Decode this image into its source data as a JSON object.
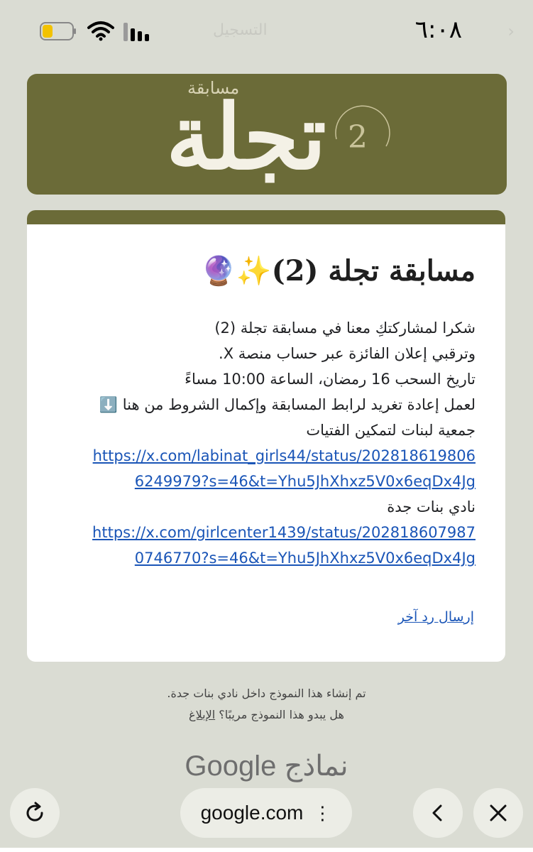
{
  "status_bar": {
    "time": "٦:٠٨",
    "faded_title": "التسجيل"
  },
  "banner": {
    "small_text": "مسابقة",
    "big_text": "تجلة",
    "number": "2"
  },
  "form": {
    "title": "مسابقة تجلة (2)✨🔮",
    "lines": {
      "l1": "شكرا لمشاركتكِ معنا في مسابقة تجلة (2)",
      "l2": "وترقبي إعلان الفائزة عبر حساب منصة X.",
      "l3": "تاريخ السحب 16 رمضان، الساعة 10:00 مساءً",
      "l4": "لعمل إعادة تغريد لرابط المسابقة وإكمال الشروط من هنا ⬇️",
      "l5": "جمعية لبنات لتمكين الفتيات",
      "link1_part1": "https://x.com/labinat_girls44/status/202818619806",
      "link1_part2": "6249979?s=46&t=Yhu5JhXhxz5V0x6eqDx4Jg",
      "l6": "نادي بنات جدة",
      "link2_part1": "https://x.com/girlcenter1439/status/202818607987",
      "link2_part2": "0746770?s=46&t=Yhu5JhXhxz5V0x6eqDx4Jg"
    },
    "resend_link": "إرسال رد آخر"
  },
  "footer": {
    "created_note": "تم إنشاء هذا النموذج داخل نادي بنات جدة.",
    "suspicious_question": "هل يبدو هذا النموذج مريبًا؟",
    "report_link": "الإبلاغ",
    "brand_google": "Google",
    "brand_forms": "نماذج"
  },
  "browser": {
    "url": "google.com",
    "menu_dots": "⋮"
  },
  "colors": {
    "accent": "#6b6b38",
    "link": "#1a55b7",
    "background": "#dadcd3"
  }
}
